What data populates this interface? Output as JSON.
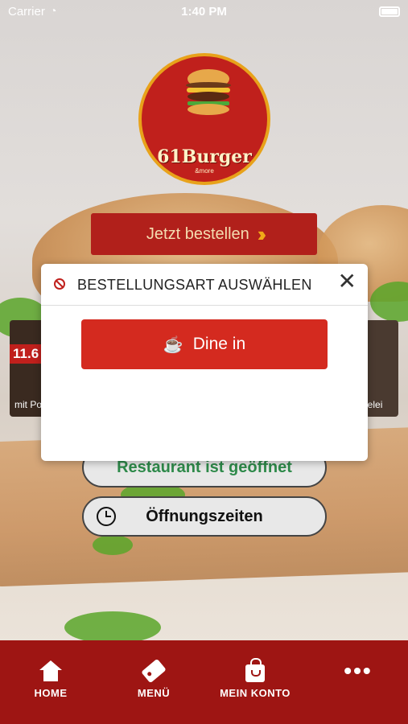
{
  "status_bar": {
    "carrier": "Carrier",
    "time": "1:40 PM"
  },
  "logo": {
    "name": "61Burger",
    "tagline": "&more"
  },
  "order_button": {
    "label": "Jetzt bestellen"
  },
  "side_cards": {
    "left_price": "11.6",
    "left_caption": "mit Po",
    "right_caption": "gelei"
  },
  "status_pill": {
    "label": "Restaurant ist geöffnet"
  },
  "hours_pill": {
    "label": "Öffnungszeiten"
  },
  "dialog": {
    "title": "BESTELLUNGSART AUSWÄHLEN",
    "dine_in_label": "Dine in"
  },
  "tabbar": {
    "items": [
      {
        "label": "HOME",
        "icon": "home-icon"
      },
      {
        "label": "MENÜ",
        "icon": "tag-icon"
      },
      {
        "label": "MEIN KONTO",
        "icon": "shopping-bag-icon"
      },
      {
        "label": "",
        "icon": "more-dots-icon"
      }
    ]
  },
  "colors": {
    "brand_red": "#9e1513",
    "button_red": "#d42a1f",
    "accent_gold": "#e8a21a",
    "open_green": "#2e8a4a"
  }
}
